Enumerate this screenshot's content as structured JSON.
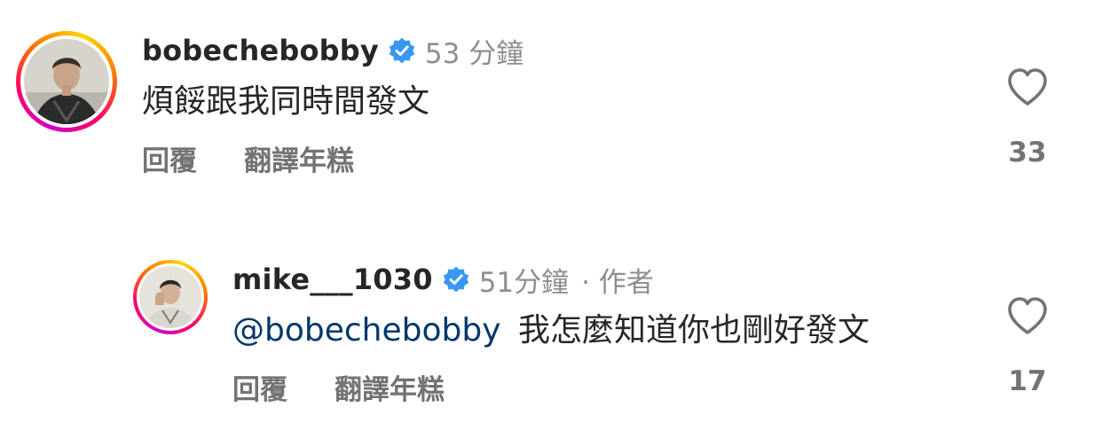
{
  "comments": [
    {
      "username": "bobechebobby",
      "verified_icon": "verified-badge-icon",
      "time": "53 分鐘",
      "author_tag": "",
      "mention": "",
      "text": "煩餒跟我同時間發文",
      "reply_label": "回覆",
      "translate_label": "翻譯年糕",
      "likes": "33",
      "like_icon": "heart-outline-icon"
    },
    {
      "username": "mike___1030",
      "verified_icon": "verified-badge-icon",
      "time": "51分鐘",
      "author_tag": "· 作者",
      "mention": "@bobechebobby",
      "text": "我怎麼知道你也剛好發文",
      "reply_label": "回覆",
      "translate_label": "翻譯年糕",
      "likes": "17",
      "like_icon": "heart-outline-icon"
    }
  ],
  "colors": {
    "primary_text": "#262626",
    "secondary_text": "#8e8e8e",
    "action_text": "#737373",
    "mention": "#00376b",
    "verified": "#3897f0"
  }
}
